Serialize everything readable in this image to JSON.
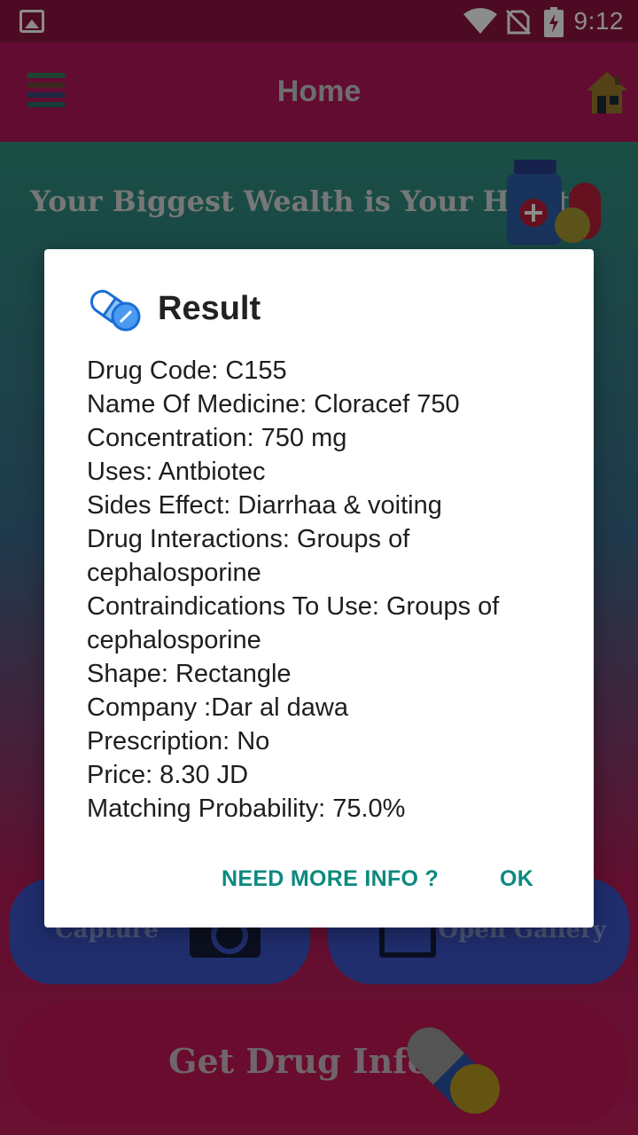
{
  "status_bar": {
    "time": "9:12"
  },
  "toolbar": {
    "title": "Home"
  },
  "main": {
    "tagline": "Your Biggest Wealth is Your Health",
    "capture_label": "Capture",
    "gallery_label": "Open Gallery",
    "drug_info_label": "Get Drug Info"
  },
  "dialog": {
    "title": "Result",
    "lines": {
      "code": "Drug Code: C155",
      "name": "Name Of Medicine: Cloracef 750",
      "concentration": "Concentration: 750 mg",
      "uses": "Uses: Antbiotec",
      "side_effects": "Sides Effect: Diarrhaa & voiting",
      "interactions": "Drug Interactions: Groups of cephalosporine",
      "contraindications": "Contraindications To Use: Groups of cephalosporine",
      "shape": "Shape: Rectangle",
      "company": "Company :Dar al dawa",
      "prescription": "Prescription: No",
      "price": "Price: 8.30 JD",
      "probability": "Matching Probability: 75.0%"
    },
    "more_info_label": "NEED MORE INFO ?",
    "ok_label": "OK"
  },
  "colors": {
    "status_bar": "#8c1440",
    "toolbar": "#b3165a",
    "accent": "#0c8a7f",
    "button_blue": "#3b55c9",
    "button_pink": "#c01652"
  },
  "icons": [
    "image-icon",
    "wifi-icon",
    "no-sim-icon",
    "battery-charging-icon",
    "menu-icon",
    "home-icon",
    "medicine-bottle-icon",
    "camera-icon",
    "gallery-icon",
    "capsule-icon",
    "pill-icon"
  ]
}
